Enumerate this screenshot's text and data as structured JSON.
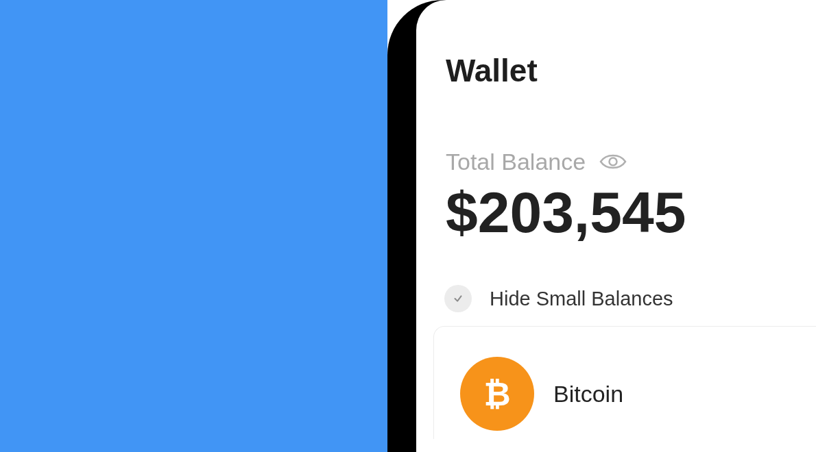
{
  "screen": {
    "title": "Wallet",
    "balance_label": "Total Balance",
    "balance": "$203,545",
    "hide_small_balances": {
      "label": "Hide Small Balances",
      "checked": false
    },
    "assets": [
      {
        "name": "Bitcoin",
        "color": "#f7931a",
        "symbol": "₿"
      }
    ]
  }
}
